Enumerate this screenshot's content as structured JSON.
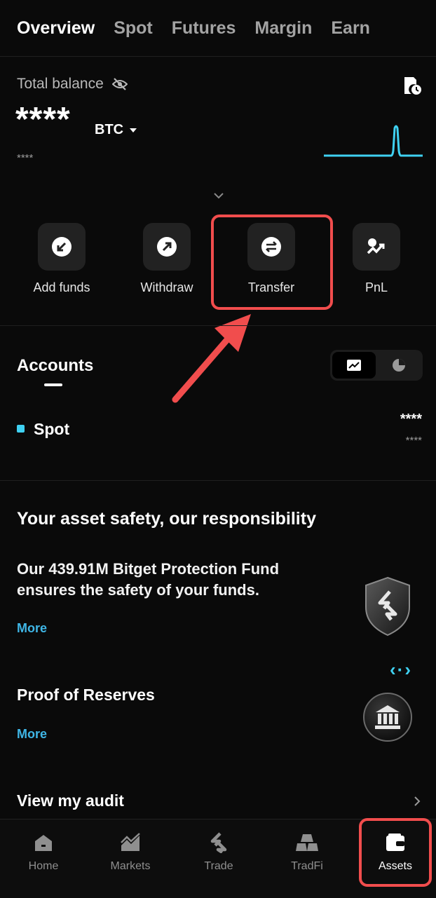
{
  "tabs": [
    "Overview",
    "Spot",
    "Futures",
    "Margin",
    "Earn"
  ],
  "balance": {
    "label": "Total balance",
    "value": "****",
    "unit": "BTC",
    "sub_value": "****"
  },
  "actions": [
    {
      "label": "Add funds",
      "icon": "add-funds-icon"
    },
    {
      "label": "Withdraw",
      "icon": "withdraw-icon"
    },
    {
      "label": "Transfer",
      "icon": "transfer-icon"
    },
    {
      "label": "PnL",
      "icon": "pnl-icon"
    }
  ],
  "accounts": {
    "title": "Accounts",
    "items": [
      {
        "name": "Spot",
        "value": "****",
        "sub_value": "****",
        "color": "#3fd1f2"
      }
    ]
  },
  "safety": {
    "title": "Your asset safety, our responsibility",
    "body": "Our 439.91M Bitget Protection Fund ensures the safety of your funds.",
    "more": "More"
  },
  "proof": {
    "title": "Proof of Reserves",
    "more": "More"
  },
  "audit": {
    "label": "View my audit"
  },
  "nav": [
    {
      "label": "Home",
      "icon": "home-icon"
    },
    {
      "label": "Markets",
      "icon": "markets-icon"
    },
    {
      "label": "Trade",
      "icon": "trade-icon"
    },
    {
      "label": "TradFi",
      "icon": "tradfi-icon"
    },
    {
      "label": "Assets",
      "icon": "wallet-icon"
    }
  ],
  "colors": {
    "accent": "#3fd1f2",
    "link": "#3fb6e6",
    "highlight": "#f14d4d"
  }
}
